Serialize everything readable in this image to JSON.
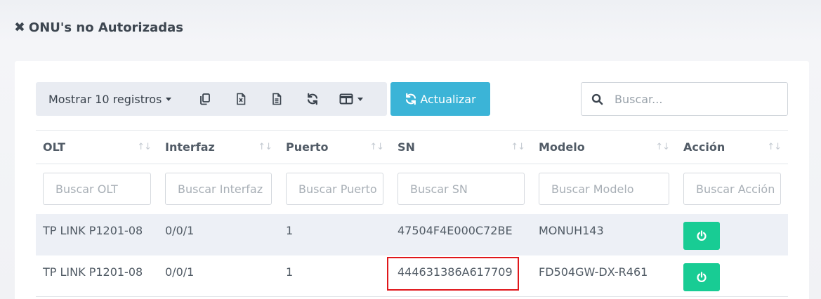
{
  "header": {
    "title": "ONU's no Autorizadas",
    "icon": "close-icon"
  },
  "toolbar": {
    "length_label": "Mostrar 10 registros",
    "buttons": [
      "copy-icon",
      "excel-icon",
      "csv-icon",
      "reload-icon",
      "columns-icon"
    ],
    "update_label": "Actualizar"
  },
  "search": {
    "placeholder": "Buscar...",
    "value": ""
  },
  "table": {
    "columns": [
      "OLT",
      "Interfaz",
      "Puerto",
      "SN",
      "Modelo",
      "Acción"
    ],
    "filters": [
      "Buscar OLT",
      "Buscar Interfaz",
      "Buscar Puerto",
      "Buscar SN",
      "Buscar Modelo",
      "Buscar Acción"
    ],
    "rows": [
      {
        "olt": "TP LINK P1201-08",
        "interfaz": "0/0/1",
        "puerto": "1",
        "sn": "47504F4E000C72BE",
        "modelo": "MONUH143"
      },
      {
        "olt": "TP LINK P1201-08",
        "interfaz": "0/0/1",
        "puerto": "1",
        "sn": "444631386A617709",
        "modelo": "FD504GW-DX-R461"
      }
    ]
  },
  "colors": {
    "accent_info": "#3bb4d7",
    "accent_success": "#18cc94",
    "highlight": "#e0171b"
  }
}
